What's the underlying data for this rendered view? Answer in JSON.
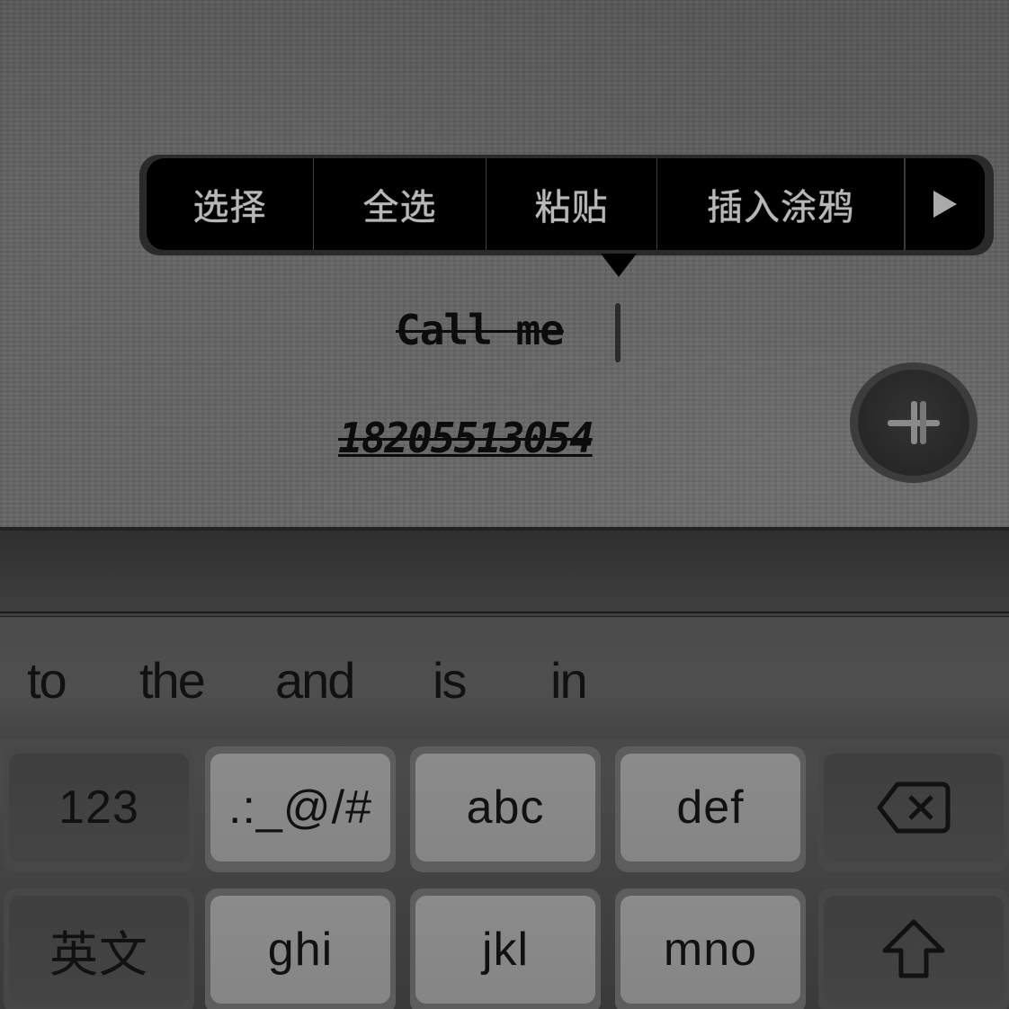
{
  "context_menu": {
    "items": [
      {
        "label": "选择"
      },
      {
        "label": "全选"
      },
      {
        "label": "粘贴"
      },
      {
        "label": "插入涂鸦"
      }
    ],
    "more_icon": "play-triangle-icon"
  },
  "note": {
    "line1": "Call me",
    "line2": "18205513054"
  },
  "add_button": {
    "icon": "plus-icon"
  },
  "keyboard": {
    "suggestions": [
      "to",
      "the",
      "and",
      "is",
      "in"
    ],
    "row1": {
      "numbers": "123",
      "symbols": ".:_@/#",
      "abc": "abc",
      "def": "def",
      "backspace_icon": "backspace-icon"
    },
    "row2": {
      "lang": "英文",
      "ghi": "ghi",
      "jkl": "jkl",
      "mno": "mno",
      "shift_icon": "shift-icon"
    }
  }
}
